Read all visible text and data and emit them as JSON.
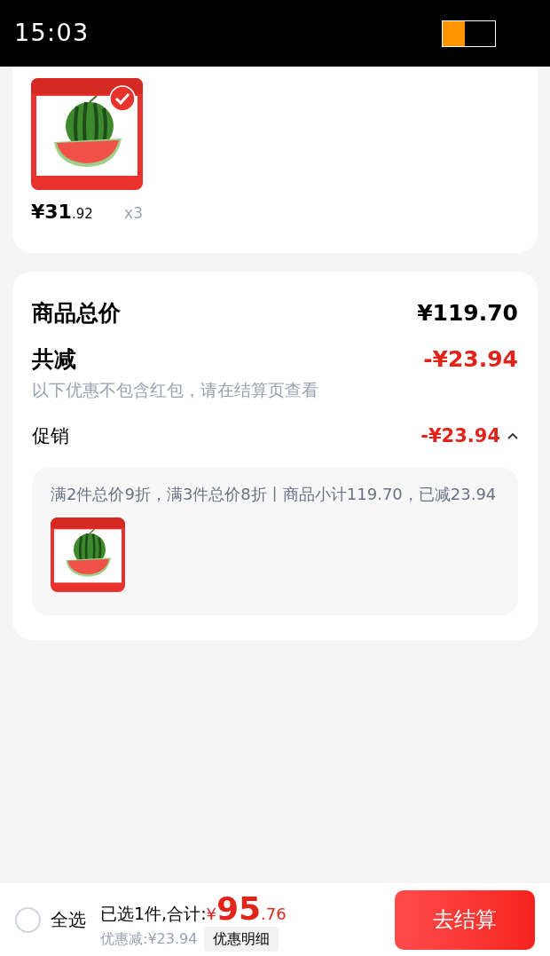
{
  "status_bar": {
    "time": "15:03"
  },
  "cart_item": {
    "selected": true,
    "price": {
      "main": "¥31",
      "fraction": ".92"
    },
    "quantity": "x3"
  },
  "summary": {
    "total_label": "商品总价",
    "total_value": "¥119.70",
    "discount_label": "共减",
    "discount_value": "-¥23.94",
    "discount_note": "以下优惠不包含红包，请在结算页查看",
    "promotion": {
      "label": "促销",
      "value": "-¥23.94",
      "expanded": true,
      "detail": "满2件总价9折，满3件总价8折丨商品小计119.70，已减23.94"
    }
  },
  "bottom_bar": {
    "select_all": {
      "label": "全选",
      "checked": false
    },
    "selected_text": "已选1件,合计:",
    "total": {
      "currency": "¥",
      "main": "95",
      "fraction": ".76"
    },
    "saved": "优惠减:¥23.94",
    "details_button": "优惠明细",
    "checkout_button": "去结算"
  }
}
